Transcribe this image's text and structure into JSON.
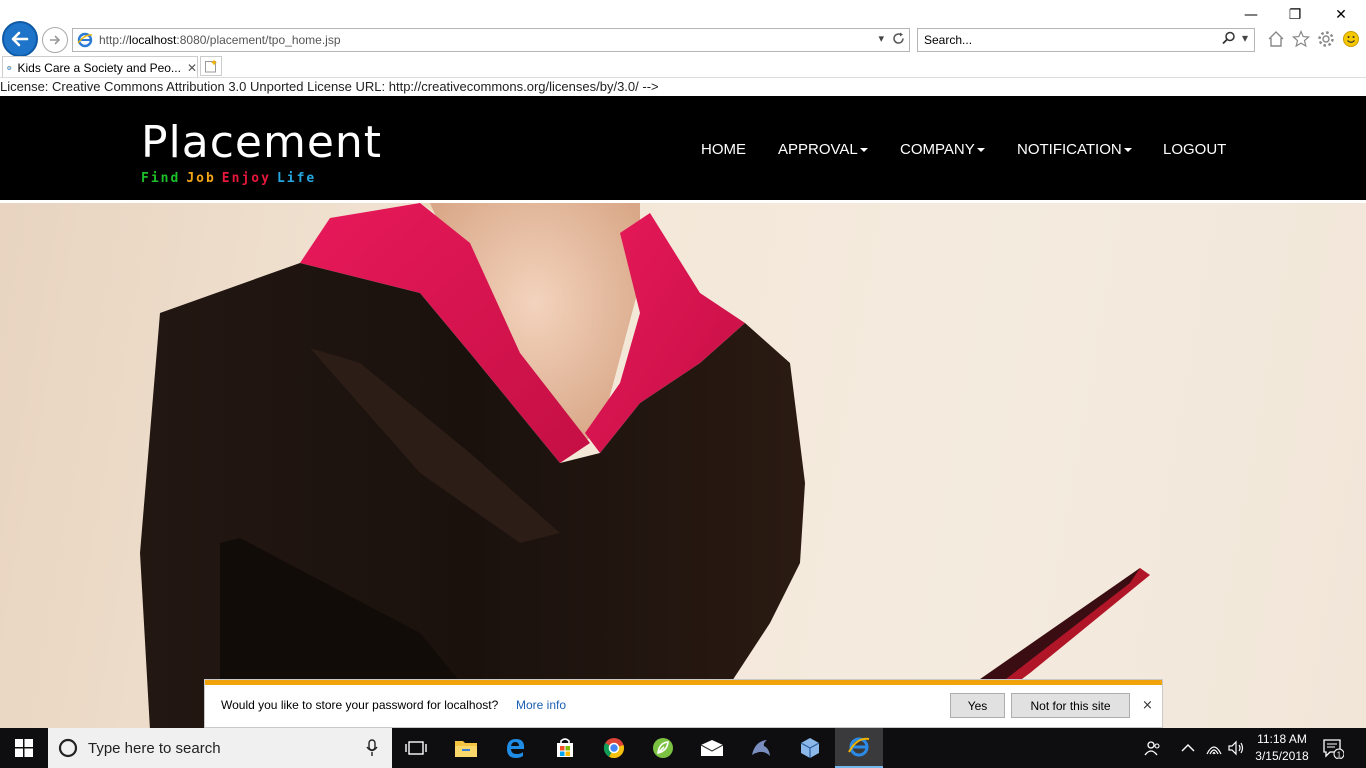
{
  "browser": {
    "url_prefix": "http://",
    "url_host": "localhost",
    "url_rest": ":8080/placement/tpo_home.jsp",
    "search_placeholder": "Search...",
    "tab_title": "Kids Care a Society and Peo...",
    "win_minimize": "—",
    "win_restore": "❐",
    "win_close": "✕"
  },
  "page": {
    "license_text": "License: Creative Commons Attribution 3.0 Unported License URL: http://creativecommons.org/licenses/by/3.0/ -->",
    "brand": "Placement",
    "tagline": [
      {
        "word": "Find",
        "color": "#1bbf2a"
      },
      {
        "word": "Job",
        "color": "#f2a516"
      },
      {
        "word": "Enjoy",
        "color": "#e8173c"
      },
      {
        "word": "Life",
        "color": "#25a8e0"
      }
    ],
    "nav": {
      "home": "HOME",
      "approval": "APPROVAL",
      "company": "COMPANY",
      "notification": "NOTIFICATION",
      "logout": "LOGOUT"
    }
  },
  "notification_bar": {
    "message": "Would you like to store your password for localhost?",
    "more_info": "More info",
    "yes": "Yes",
    "not_for_site": "Not for this site",
    "close": "×"
  },
  "taskbar": {
    "search_placeholder": "Type here to search",
    "time": "11:18 AM",
    "date": "3/15/2018",
    "notification_count": "1"
  }
}
